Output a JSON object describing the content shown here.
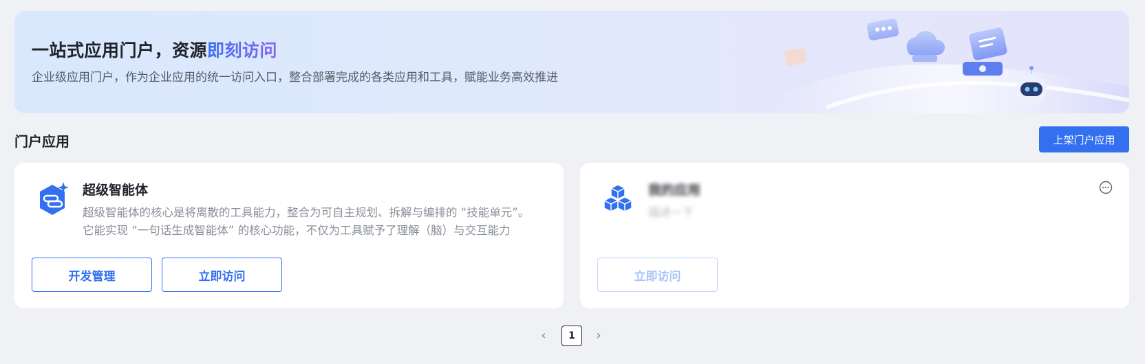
{
  "banner": {
    "title_prefix": "一站式应用门户，资源",
    "title_highlight": "即刻访问",
    "subtitle": "企业级应用门户，作为企业应用的统一访问入口，整合部署完成的各类应用和工具，赋能业务高效推进"
  },
  "section": {
    "title": "门户应用",
    "publish_button": "上架门户应用"
  },
  "apps": [
    {
      "name": "超级智能体",
      "description": "超级智能体的核心是将离散的工具能力，整合为可自主规划、拆解与编排的 “技能单元”。它能实现 “一句话生成智能体” 的核心功能，不仅为工具赋予了理解（脑）与交互能力",
      "icon": "agent-sparkle-icon",
      "buttons": [
        "开发管理",
        "立即访问"
      ]
    },
    {
      "name": "我的应用",
      "description": "描述一下",
      "icon": "cubes-icon",
      "buttons": [
        "立即访问"
      ]
    }
  ],
  "pagination": {
    "current_page": "1",
    "prev": "‹",
    "next": "›"
  },
  "colors": {
    "primary": "#3370f0",
    "background": "#f0f1f4"
  }
}
